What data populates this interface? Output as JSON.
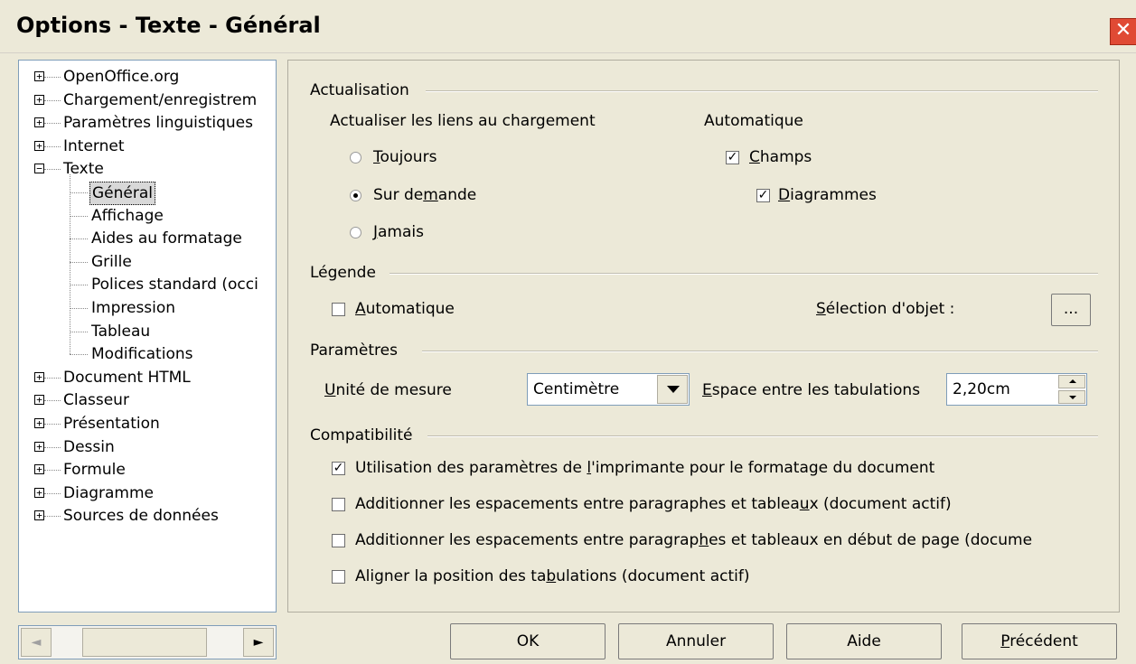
{
  "window": {
    "title": "Options - Texte - Général",
    "close_glyph": "✕"
  },
  "tree": {
    "items": [
      {
        "label": "OpenOffice.org",
        "expander": "+"
      },
      {
        "label": "Chargement/enregistrem",
        "expander": "+"
      },
      {
        "label": "Paramètres linguistiques",
        "expander": "+"
      },
      {
        "label": "Internet",
        "expander": "+"
      },
      {
        "label": "Texte",
        "expander": "−"
      },
      {
        "label": "Général",
        "selected": true
      },
      {
        "label": "Affichage"
      },
      {
        "label": "Aides au formatage"
      },
      {
        "label": "Grille"
      },
      {
        "label": "Polices standard (occi"
      },
      {
        "label": "Impression"
      },
      {
        "label": "Tableau"
      },
      {
        "label": "Modifications"
      },
      {
        "label": "Document HTML",
        "expander": "+"
      },
      {
        "label": "Classeur",
        "expander": "+"
      },
      {
        "label": "Présentation",
        "expander": "+"
      },
      {
        "label": "Dessin",
        "expander": "+"
      },
      {
        "label": "Formule",
        "expander": "+"
      },
      {
        "label": "Diagramme",
        "expander": "+"
      },
      {
        "label": "Sources de données",
        "expander": "+"
      }
    ],
    "scroll_left_glyph": "◄",
    "scroll_right_glyph": "►"
  },
  "actualisation": {
    "section_title": "Actualisation",
    "links_label": "Actualiser les liens au chargement",
    "radios": [
      {
        "pre": "",
        "mn": "T",
        "post": "oujours",
        "checked": false
      },
      {
        "pre": "Sur de",
        "mn": "m",
        "post": "ande",
        "checked": true
      },
      {
        "pre": "",
        "mn": "J",
        "post": "amais",
        "checked": false
      }
    ],
    "auto_label": "Automatique",
    "champs": {
      "pre": "",
      "mn": "C",
      "post": "hamps",
      "checked": true
    },
    "diagrammes": {
      "pre": "",
      "mn": "D",
      "post": "iagrammes",
      "checked": true
    }
  },
  "legende": {
    "section_title": "Légende",
    "auto": {
      "pre": "",
      "mn": "A",
      "post": "utomatique",
      "checked": false
    },
    "selection_label": {
      "pre": "",
      "mn": "S",
      "post": "élection d'objet :"
    },
    "browse_button": "..."
  },
  "parametres": {
    "section_title": "Paramètres",
    "unit_label": {
      "pre": "",
      "mn": "U",
      "post": "nité de mesure"
    },
    "unit_value": "Centimètre",
    "tab_label": {
      "pre": "",
      "mn": "E",
      "post": "space entre les tabulations"
    },
    "tab_value": "2,20cm"
  },
  "compatibilite": {
    "section_title": "Compatibilité",
    "options": [
      {
        "pre": "Utilisation des paramètres de ",
        "mn": "l",
        "post": "'imprimante pour le formatage du document",
        "checked": true
      },
      {
        "pre": "Additionner les espacements entre paragraphes et tablea",
        "mn": "u",
        "post": "x (document actif)",
        "checked": false
      },
      {
        "pre": "Additionner les espacements entre paragrap",
        "mn": "h",
        "post": "es et tableaux en début de page (docume",
        "checked": false
      },
      {
        "pre": "Aligner la position des ta",
        "mn": "b",
        "post": "ulations (document actif)",
        "checked": false
      }
    ]
  },
  "buttons": {
    "ok": "OK",
    "cancel": "Annuler",
    "help": "Aide",
    "back": {
      "pre": "",
      "mn": "P",
      "post": "récédent"
    }
  }
}
